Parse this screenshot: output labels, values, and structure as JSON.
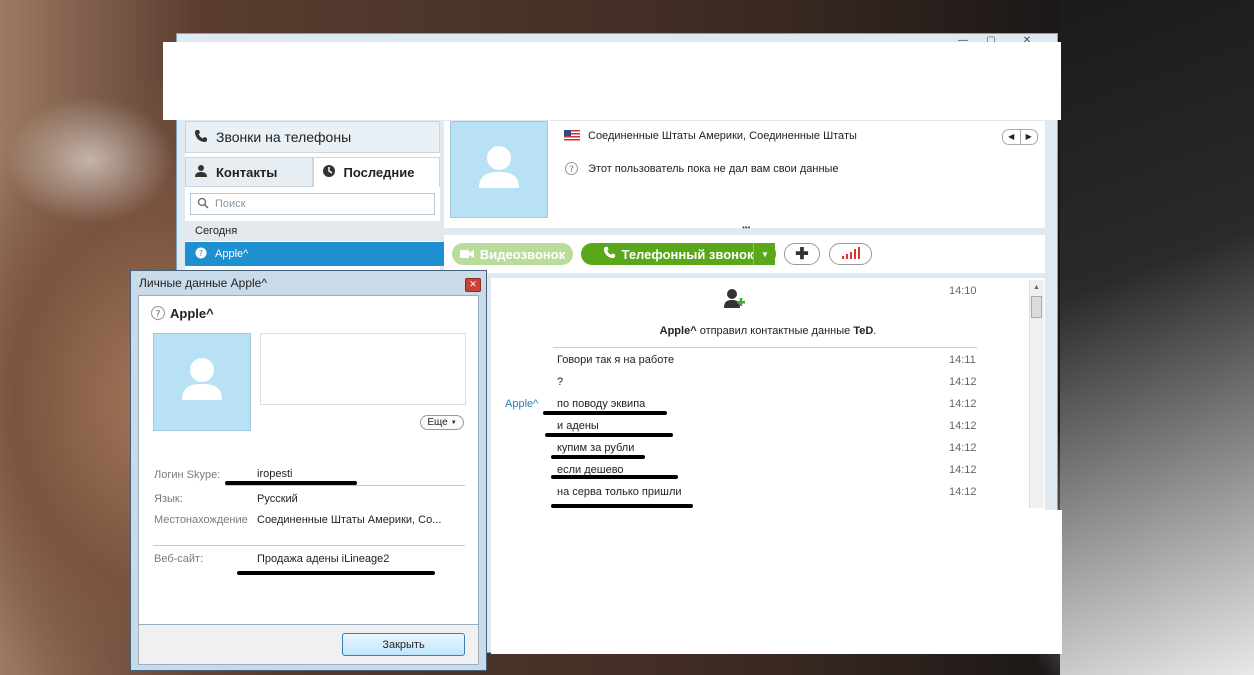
{
  "sidebar": {
    "calls_label": "Звонки на телефоны",
    "tab_contacts": "Контакты",
    "tab_recent": "Последние",
    "search_placeholder": "Поиск",
    "group_today": "Сегодня",
    "selected_contact": "Apple^"
  },
  "profile": {
    "location": "Соединенные Штаты Америки, Соединенные Штаты",
    "notice": "Этот пользователь пока не дал вам свои данные"
  },
  "actions": {
    "video_call": "Видеозвонок",
    "phone_call": "Телефонный звонок"
  },
  "chat": {
    "header_time": "14:10",
    "contact_sender": "Apple^",
    "contact_sent_text": "отправил контактные данные",
    "contact_target": "TeD",
    "contact_target_suffix": ".",
    "sender_label": "Apple^",
    "messages": [
      {
        "text": "Говори так я на работе",
        "time": "14:11"
      },
      {
        "text": "?",
        "time": "14:12"
      },
      {
        "text": "по поводу эквипа",
        "time": "14:12"
      },
      {
        "text": "и адены",
        "time": "14:12"
      },
      {
        "text": "купим за рубли",
        "time": "14:12"
      },
      {
        "text": "если дешево",
        "time": "14:12"
      },
      {
        "text": "на серва только пришли",
        "time": "14:12"
      }
    ]
  },
  "dialog": {
    "title": "Личные данные Apple^",
    "name": "Apple^",
    "more_button": "Еще",
    "login_label": "Логин Skype:",
    "login_value": "iropesti",
    "language_label": "Язык:",
    "language_value": "Русский",
    "location_label": "Местонахождение",
    "location_value": "Соединенные Штаты Америки, Со...",
    "website_label": "Веб-сайт:",
    "website_value": "Продажа адены iLineage2",
    "close_button": "Закрыть"
  },
  "colors": {
    "accent_blue": "#1e8fd0",
    "call_green": "#5ba71b",
    "avatar_bg": "#b8e1f5"
  }
}
